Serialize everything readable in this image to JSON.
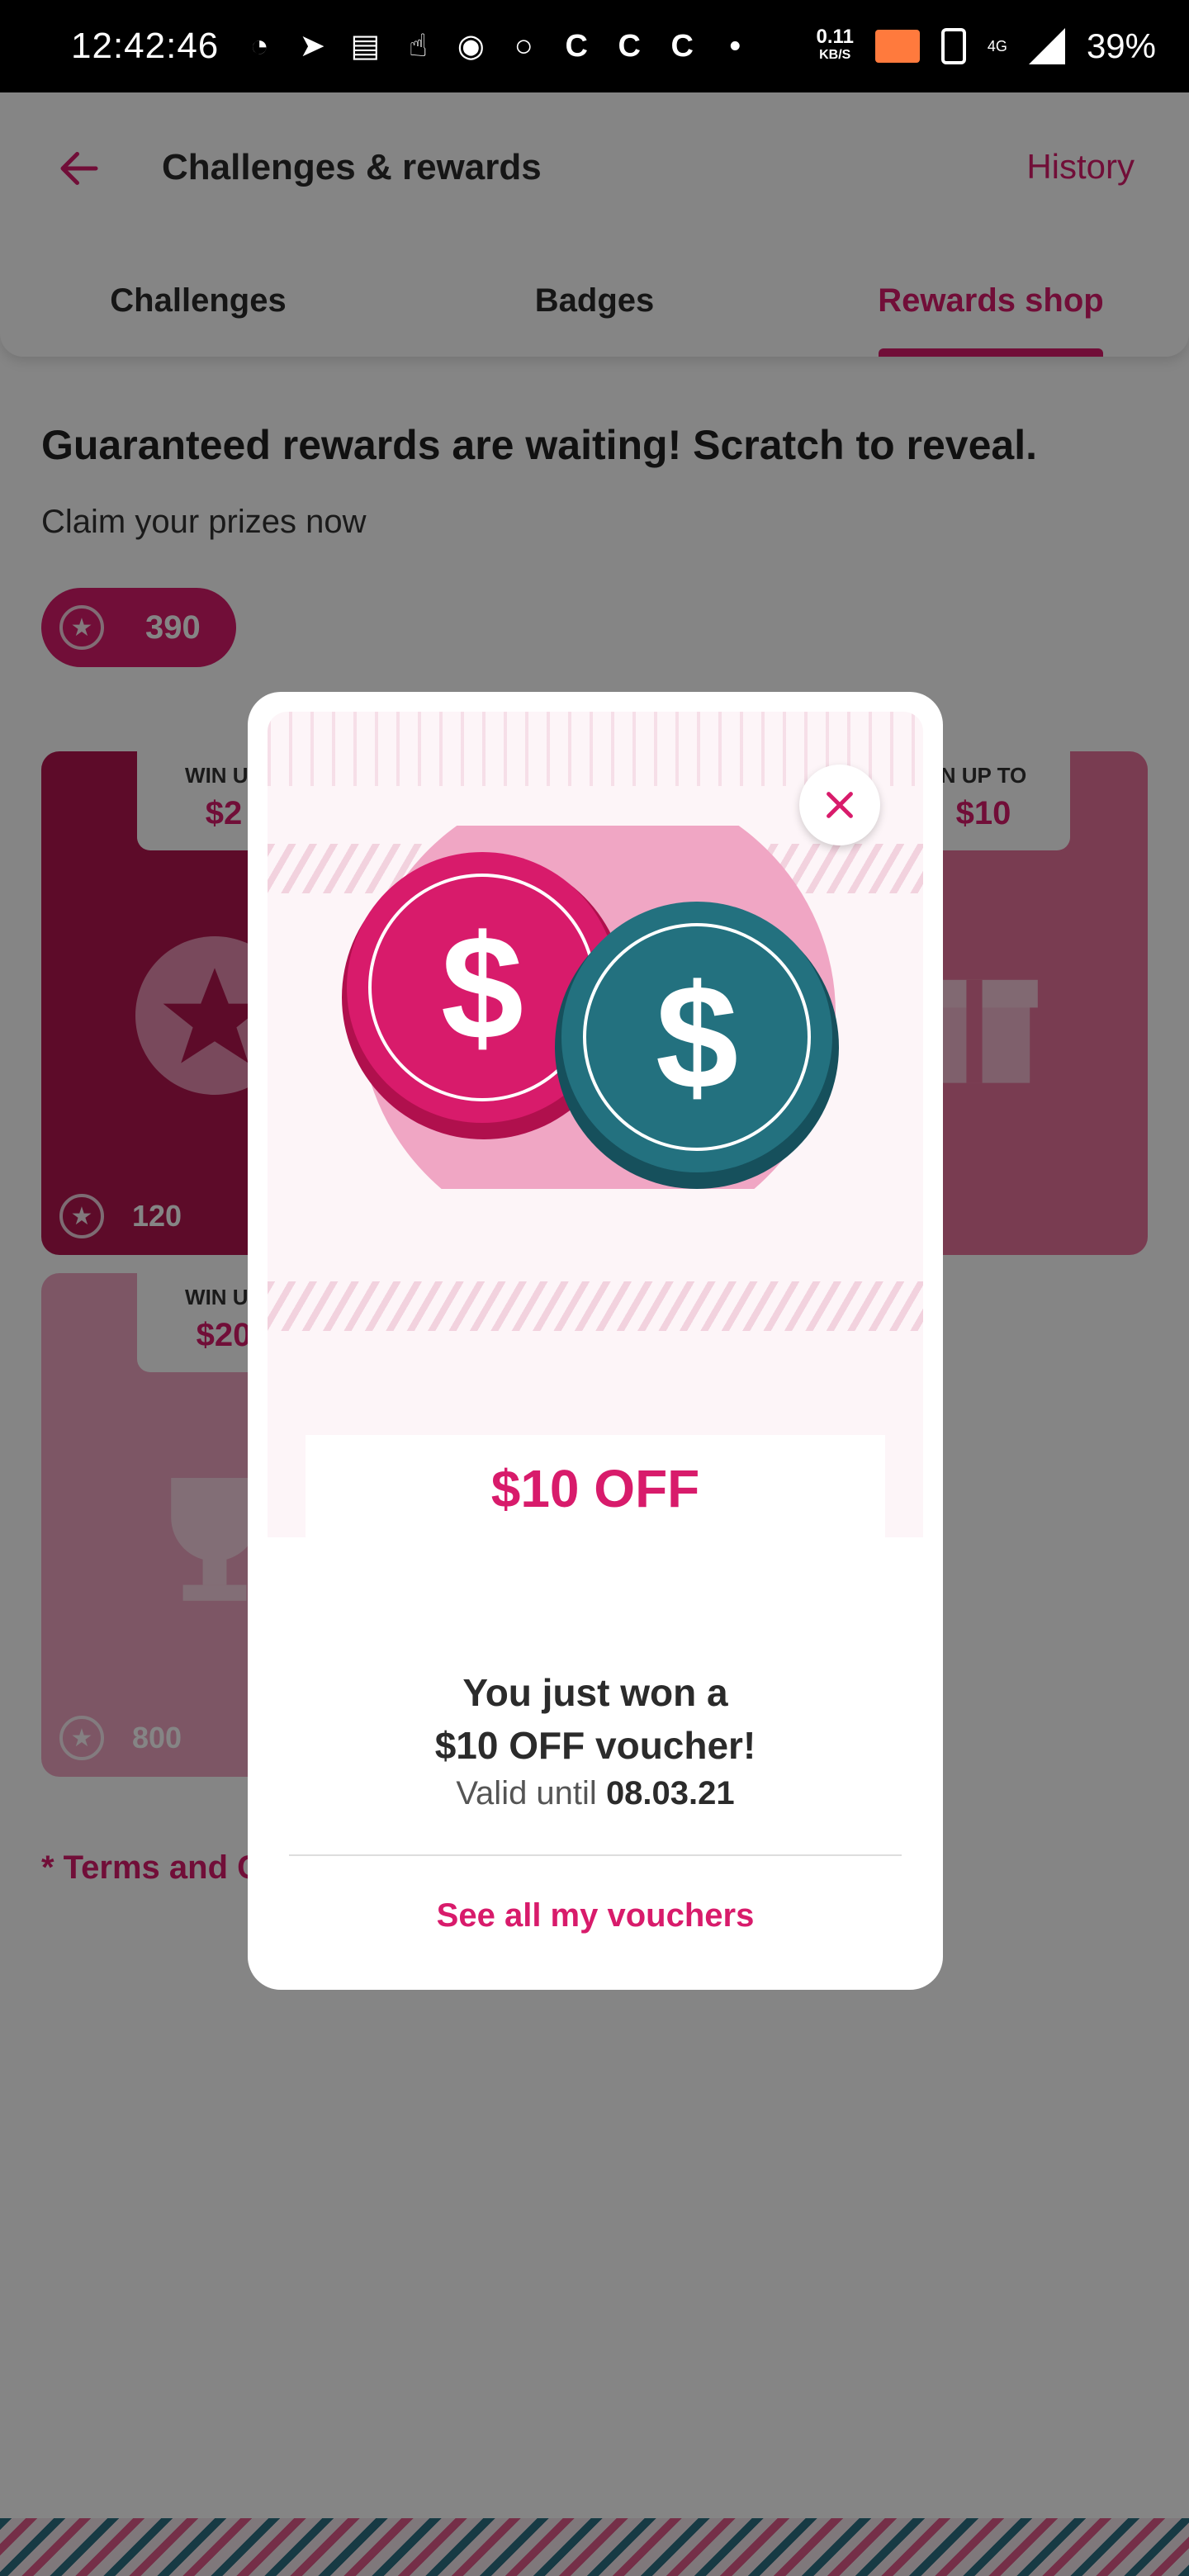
{
  "status_bar": {
    "time": "12:42:46",
    "speed_value": "0.11",
    "speed_unit": "KB/S",
    "network": "4G",
    "battery": "39%",
    "icons": [
      "whatsapp-icon",
      "telegram-icon",
      "message-icon",
      "touch-icon",
      "record-icon",
      "circle-icon",
      "c-icon",
      "c-icon",
      "c-icon",
      "dot-icon",
      "cast-icon",
      "vibrate-icon",
      "signal-icon"
    ]
  },
  "header": {
    "title": "Challenges & rewards",
    "history": "History",
    "tabs": [
      {
        "label": "Challenges",
        "active": false
      },
      {
        "label": "Badges",
        "active": false
      },
      {
        "label": "Rewards shop",
        "active": true
      }
    ]
  },
  "main": {
    "headline": "Guaranteed rewards are waiting! Scratch to reveal.",
    "subline": "Claim your prizes now",
    "points": "390",
    "cards": [
      {
        "tag_line1": "WIN UP",
        "tag_line2": "$2",
        "cost": "120",
        "icon": "badge-star-icon"
      },
      {
        "tag_line1": "N UP TO",
        "tag_line2": "$10",
        "cost": "",
        "icon": "gift-icon"
      },
      {
        "tag_line1": "WIN UP",
        "tag_line2": "$20",
        "cost": "800",
        "icon": "trophy-icon"
      }
    ],
    "terms": "* Terms and C"
  },
  "modal": {
    "offer_banner": "$10 OFF",
    "won_line1": "You just won a",
    "won_line2": "$10 OFF voucher!",
    "valid_prefix": "Valid until",
    "valid_date": "08.03.21",
    "link": "See all my vouchers"
  },
  "colors": {
    "accent": "#d81b6b",
    "coin_pink": "#d81b6b",
    "coin_teal": "#23717f",
    "overlay": "#000000"
  }
}
